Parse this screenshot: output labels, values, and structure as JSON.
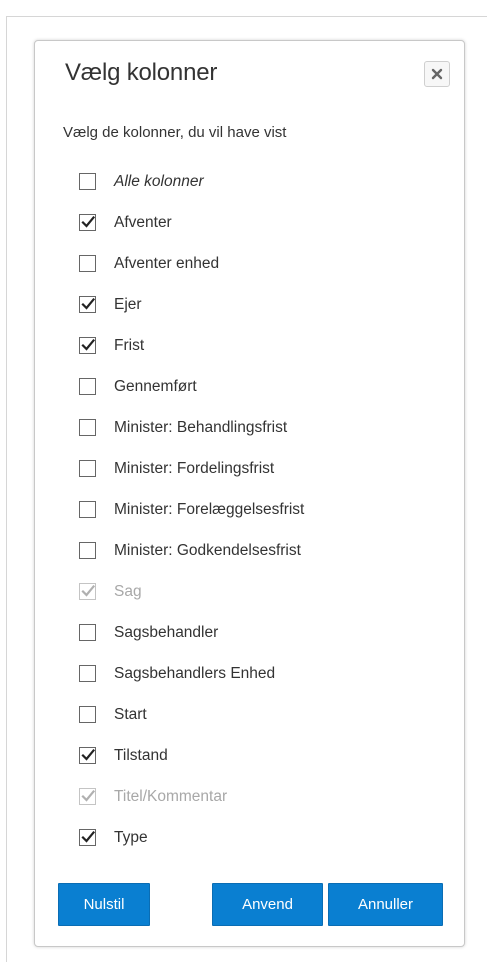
{
  "dialog": {
    "title": "Vælg kolonner",
    "subtitle": "Vælg de kolonner, du vil have vist",
    "close_icon": "close-icon"
  },
  "options": [
    {
      "label": "Alle kolonner",
      "checked": false,
      "disabled": false,
      "italic": true,
      "name": "alle-kolonner"
    },
    {
      "label": "Afventer",
      "checked": true,
      "disabled": false,
      "italic": false,
      "name": "afventer"
    },
    {
      "label": "Afventer enhed",
      "checked": false,
      "disabled": false,
      "italic": false,
      "name": "afventer-enhed"
    },
    {
      "label": "Ejer",
      "checked": true,
      "disabled": false,
      "italic": false,
      "name": "ejer"
    },
    {
      "label": "Frist",
      "checked": true,
      "disabled": false,
      "italic": false,
      "name": "frist"
    },
    {
      "label": "Gennemført",
      "checked": false,
      "disabled": false,
      "italic": false,
      "name": "gennemfort"
    },
    {
      "label": "Minister: Behandlingsfrist",
      "checked": false,
      "disabled": false,
      "italic": false,
      "name": "minister-behandlingsfrist"
    },
    {
      "label": "Minister: Fordelingsfrist",
      "checked": false,
      "disabled": false,
      "italic": false,
      "name": "minister-fordelingsfrist"
    },
    {
      "label": "Minister: Forelæggelsesfrist",
      "checked": false,
      "disabled": false,
      "italic": false,
      "name": "minister-forelaeggelsesfrist"
    },
    {
      "label": "Minister: Godkendelsesfrist",
      "checked": false,
      "disabled": false,
      "italic": false,
      "name": "minister-godkendelsesfrist"
    },
    {
      "label": "Sag",
      "checked": true,
      "disabled": true,
      "italic": false,
      "name": "sag"
    },
    {
      "label": "Sagsbehandler",
      "checked": false,
      "disabled": false,
      "italic": false,
      "name": "sagsbehandler"
    },
    {
      "label": "Sagsbehandlers Enhed",
      "checked": false,
      "disabled": false,
      "italic": false,
      "name": "sagsbehandlers-enhed"
    },
    {
      "label": "Start",
      "checked": false,
      "disabled": false,
      "italic": false,
      "name": "start"
    },
    {
      "label": "Tilstand",
      "checked": true,
      "disabled": false,
      "italic": false,
      "name": "tilstand"
    },
    {
      "label": "Titel/Kommentar",
      "checked": true,
      "disabled": true,
      "italic": false,
      "name": "titel-kommentar"
    },
    {
      "label": "Type",
      "checked": true,
      "disabled": false,
      "italic": false,
      "name": "type"
    }
  ],
  "buttons": {
    "reset": "Nulstil",
    "apply": "Anvend",
    "cancel": "Annuller"
  },
  "colors": {
    "primary_button": "#0a7fd1",
    "disabled_text": "#a8a8a8",
    "text": "#333333"
  }
}
